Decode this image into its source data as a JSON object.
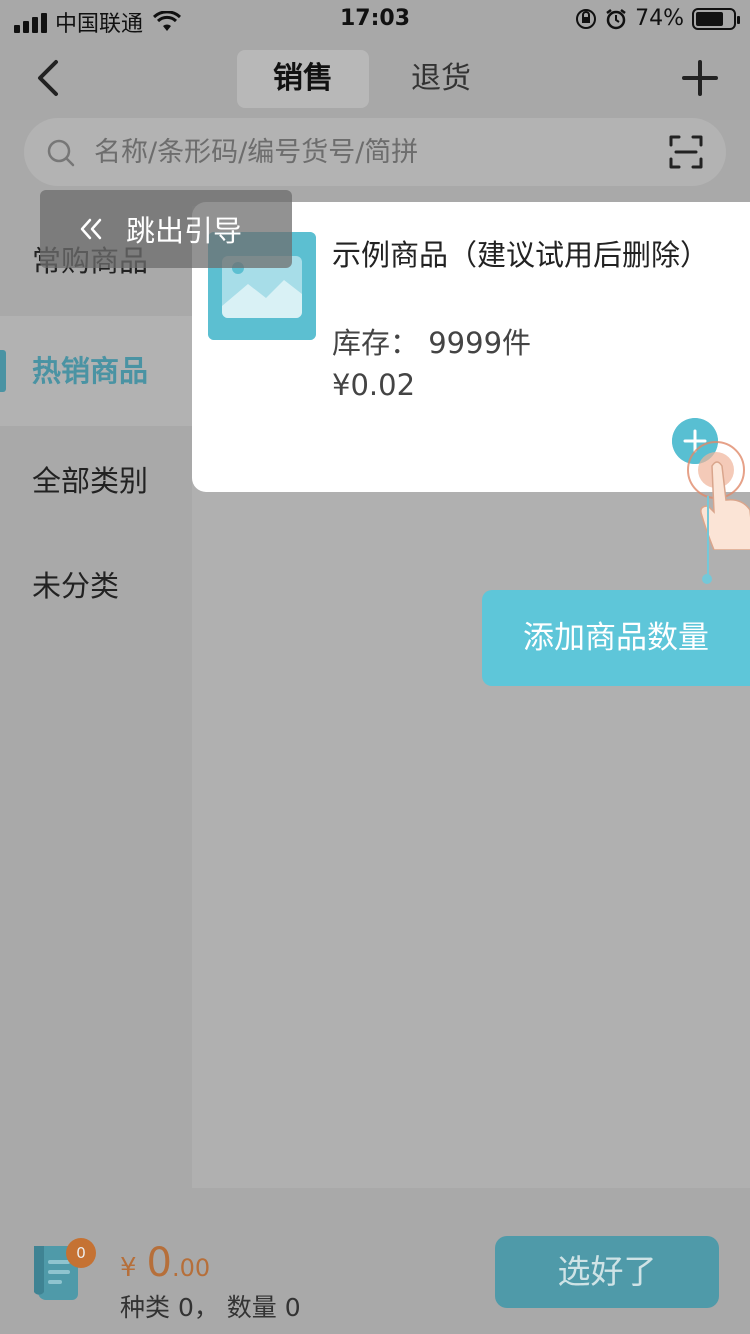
{
  "status_bar": {
    "carrier": "中国联通",
    "time": "17:03",
    "battery_percent": "74%",
    "battery_level": 0.74
  },
  "header": {
    "tabs": [
      {
        "label": "销售",
        "active": true
      },
      {
        "label": "退货",
        "active": false
      }
    ]
  },
  "search": {
    "placeholder": "名称/条形码/编号货号/简拼"
  },
  "sidebar": {
    "items": [
      {
        "label": "常购商品",
        "active": false
      },
      {
        "label": "热销商品",
        "active": true
      },
      {
        "label": "全部类别",
        "active": false
      },
      {
        "label": "未分类",
        "active": false
      }
    ]
  },
  "guide": {
    "skip_label": "跳出引导",
    "tooltip": "添加商品数量"
  },
  "product": {
    "name": "示例商品（建议试用后删除）",
    "stock": "库存：  9999件",
    "price": "¥0.02"
  },
  "bottom": {
    "badge_count": "0",
    "currency": "¥",
    "amount_integer": "0",
    "amount_decimal": ".00",
    "counts": "种类 0，  数量 0",
    "done_label": "选好了"
  },
  "colors": {
    "accent": "#5ec6d9",
    "price_orange": "#b66f3a",
    "active_category": "#4a93a3"
  }
}
